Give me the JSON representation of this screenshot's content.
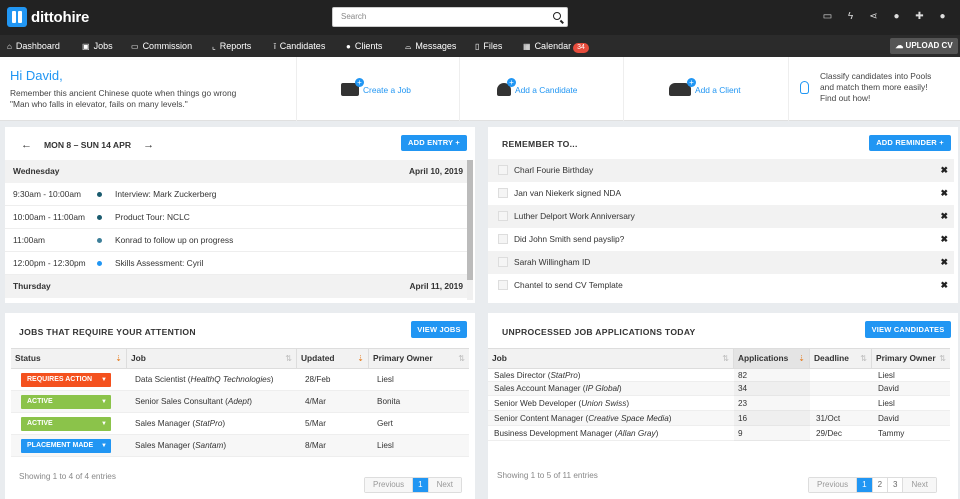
{
  "app": {
    "logo": "dittohire"
  },
  "search": {
    "placeholder": "Search"
  },
  "top_icons": [
    "monitor-icon",
    "bolt-icon",
    "share-icon",
    "bell-icon",
    "plus-icon",
    "user-icon"
  ],
  "nav": {
    "items": [
      {
        "label": "Dashboard",
        "icon": "home-icon"
      },
      {
        "label": "Jobs",
        "icon": "briefcase-icon"
      },
      {
        "label": "Commission",
        "icon": "money-icon"
      },
      {
        "label": "Reports",
        "icon": "chart-icon"
      },
      {
        "label": "Candidates",
        "icon": "person-icon"
      },
      {
        "label": "Clients",
        "icon": "users-icon"
      },
      {
        "label": "Messages",
        "icon": "inbox-icon"
      },
      {
        "label": "Files",
        "icon": "file-icon"
      },
      {
        "label": "Calendar",
        "icon": "calendar-icon",
        "badge": "34"
      }
    ],
    "upload_label": "UPLOAD CV"
  },
  "welcome": {
    "greeting": "Hi David,",
    "quote_line1": "Remember this ancient Chinese quote when things go wrong",
    "quote_line2": "\"Man who falls in elevator, fails on many levels.\"",
    "actions": [
      "Create a Job",
      "Add a Candidate",
      "Add a Client"
    ],
    "tip_line1": "Classify candidates into Pools",
    "tip_line2": "and match them more easily!",
    "tip_line3": "Find out how!"
  },
  "calendar": {
    "range": "MON 8 – SUN 14 APR",
    "add_label": "ADD ENTRY +",
    "day1": {
      "name": "Wednesday",
      "date": "April 10, 2019"
    },
    "events": [
      {
        "time": "9:30am - 10:00am",
        "text": "Interview: Mark Zuckerberg",
        "color": "#1a5b6e"
      },
      {
        "time": "10:00am - 11:00am",
        "text": "Product Tour: NCLC",
        "color": "#1a5b6e"
      },
      {
        "time": "11:00am",
        "text": "Konrad to follow up on progress",
        "color": "#3d7f99"
      },
      {
        "time": "12:00pm - 12:30pm",
        "text": "Skills Assessment: Cyril",
        "color": "#2196f3"
      }
    ],
    "day2": {
      "name": "Thursday",
      "date": "April 11, 2019"
    }
  },
  "reminders": {
    "title": "REMEMBER TO...",
    "add_label": "ADD REMINDER +",
    "items": [
      "Charl Fourie Birthday",
      "Jan van Niekerk signed NDA",
      "Luther Delport Work Anniversary",
      "Did John Smith send payslip?",
      "Sarah Willingham ID",
      "Chantel to send CV Template"
    ]
  },
  "jobs": {
    "title": "JOBS THAT REQUIRE YOUR ATTENTION",
    "view_label": "VIEW JOBS",
    "headers": [
      "Status",
      "Job",
      "Updated",
      "Primary Owner"
    ],
    "rows": [
      {
        "status": "REQUIRES ACTION",
        "status_color": "#f4511e",
        "job": "Data Scientist",
        "company": "HealthQ Technologies",
        "updated": "28/Feb",
        "owner": "Liesl"
      },
      {
        "status": "ACTIVE",
        "status_color": "#8bc34a",
        "job": "Senior Sales Consultant",
        "company": "Adept",
        "updated": "4/Mar",
        "owner": "Bonita"
      },
      {
        "status": "ACTIVE",
        "status_color": "#8bc34a",
        "job": "Sales Manager",
        "company": "StatPro",
        "updated": "5/Mar",
        "owner": "Gert"
      },
      {
        "status": "PLACEMENT MADE",
        "status_color": "#2196f3",
        "job": "Sales Manager",
        "company": "Santam",
        "updated": "8/Mar",
        "owner": "Liesl"
      }
    ],
    "showing": "Showing 1 to 4 of 4 entries",
    "pager": {
      "prev": "Previous",
      "pages": [
        "1"
      ],
      "next": "Next"
    }
  },
  "applications": {
    "title": "UNPROCESSED JOB APPLICATIONS TODAY",
    "view_label": "VIEW CANDIDATES",
    "headers": [
      "Job",
      "Applications",
      "Deadline",
      "Primary Owner"
    ],
    "rows": [
      {
        "job": "Sales Director",
        "company": "StatPro",
        "apps": "82",
        "deadline": "",
        "owner": "Liesl"
      },
      {
        "job": "Sales Account Manager",
        "company": "IP Global",
        "apps": "34",
        "deadline": "",
        "owner": "David"
      },
      {
        "job": "Senior Web Developer",
        "company": "Union Swiss",
        "apps": "23",
        "deadline": "",
        "owner": "Liesl"
      },
      {
        "job": "Senior Content Manager",
        "company": "Creative Space Media",
        "apps": "16",
        "deadline": "31/Oct",
        "owner": "David"
      },
      {
        "job": "Business Development Manager",
        "company": "Allan Gray",
        "apps": "9",
        "deadline": "29/Dec",
        "owner": "Tammy"
      }
    ],
    "showing": "Showing 1 to 5 of 11 entries",
    "pager": {
      "prev": "Previous",
      "pages": [
        "1",
        "2",
        "3"
      ],
      "next": "Next"
    }
  }
}
